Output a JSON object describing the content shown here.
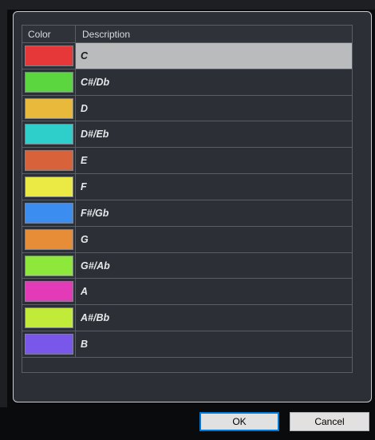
{
  "dialog": {
    "table": {
      "columns": [
        "Color",
        "Description"
      ],
      "rows": [
        {
          "description": "C",
          "color": "#e63838",
          "selected": true
        },
        {
          "description": "C#/Db",
          "color": "#5bd63f"
        },
        {
          "description": "D",
          "color": "#e9b93c"
        },
        {
          "description": "D#/Eb",
          "color": "#2ecfcb"
        },
        {
          "description": "E",
          "color": "#d8623a"
        },
        {
          "description": "F",
          "color": "#ebea45"
        },
        {
          "description": "F#/Gb",
          "color": "#3b8ef0"
        },
        {
          "description": "G",
          "color": "#e78c37"
        },
        {
          "description": "G#/Ab",
          "color": "#8ee83b"
        },
        {
          "description": "A",
          "color": "#e33ab7"
        },
        {
          "description": "A#/Bb",
          "color": "#c2ea39"
        },
        {
          "description": "B",
          "color": "#7957ea"
        }
      ]
    },
    "buttons": {
      "ok_label": "OK",
      "cancel_label": "Cancel"
    }
  }
}
